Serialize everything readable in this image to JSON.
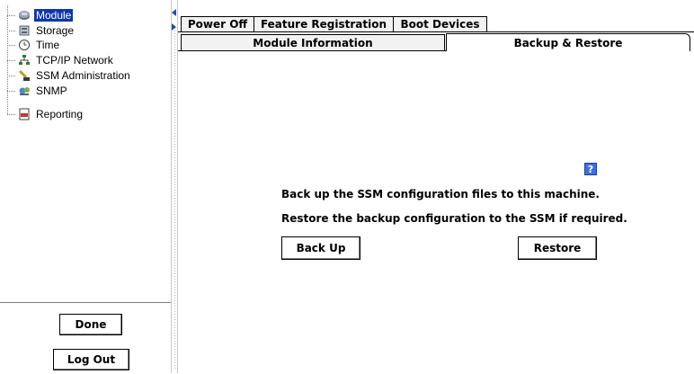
{
  "tree": {
    "items": [
      {
        "label": "Module",
        "icon": "module-icon",
        "selected": true
      },
      {
        "label": "Storage",
        "icon": "storage-icon",
        "selected": false
      },
      {
        "label": "Time",
        "icon": "clock-icon",
        "selected": false
      },
      {
        "label": "TCP/IP Network",
        "icon": "network-icon",
        "selected": false
      },
      {
        "label": "SSM Administration",
        "icon": "admin-icon",
        "selected": false
      },
      {
        "label": "SNMP",
        "icon": "snmp-icon",
        "selected": false
      },
      {
        "label": "Reporting",
        "icon": "reporting-icon",
        "selected": false
      }
    ]
  },
  "buttons": {
    "done": "Done",
    "logout": "Log Out",
    "backup": "Back Up",
    "restore": "Restore"
  },
  "tabs": {
    "row1": [
      "Power Off",
      "Feature Registration",
      "Boot Devices"
    ],
    "row2": [
      "Module Information",
      "Backup & Restore"
    ],
    "active": "Backup & Restore"
  },
  "content": {
    "help": "?",
    "backup_text": "Back up the SSM configuration files to this machine.",
    "restore_text": "Restore the backup configuration to the SSM if required."
  },
  "colors": {
    "selection": "#0c38a8",
    "help_icon": "#3f6fd8"
  }
}
